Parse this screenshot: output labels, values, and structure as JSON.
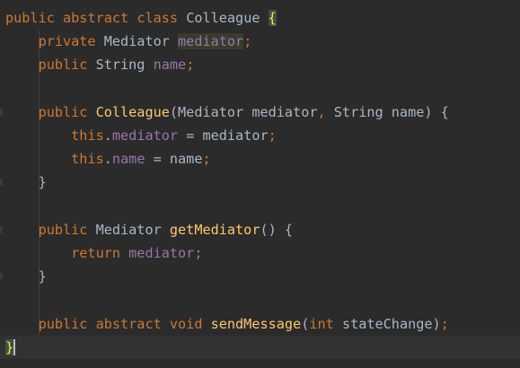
{
  "editor": {
    "lines": [
      {
        "tokens": [
          {
            "t": "public ",
            "c": "kw"
          },
          {
            "t": "abstract ",
            "c": "kw"
          },
          {
            "t": "class ",
            "c": "kw"
          },
          {
            "t": "Colleague ",
            "c": "plain"
          },
          {
            "t": "{",
            "c": "brace-match"
          }
        ]
      },
      {
        "tokens": [
          {
            "t": "    private ",
            "c": "kw"
          },
          {
            "t": "Mediator ",
            "c": "plain"
          },
          {
            "t": "mediator",
            "c": "field hl-usage"
          },
          {
            "t": ";",
            "c": "punc"
          }
        ]
      },
      {
        "tokens": [
          {
            "t": "    public ",
            "c": "kw"
          },
          {
            "t": "String ",
            "c": "plain"
          },
          {
            "t": "name",
            "c": "field"
          },
          {
            "t": ";",
            "c": "punc"
          }
        ]
      },
      {
        "tokens": []
      },
      {
        "tokens": [
          {
            "t": "    public ",
            "c": "kw"
          },
          {
            "t": "Colleague",
            "c": "fn"
          },
          {
            "t": "(Mediator mediator",
            "c": "plain"
          },
          {
            "t": ", ",
            "c": "punc"
          },
          {
            "t": "String name) {",
            "c": "plain"
          }
        ]
      },
      {
        "tokens": [
          {
            "t": "        this",
            "c": "kw"
          },
          {
            "t": ".",
            "c": "plain"
          },
          {
            "t": "mediator",
            "c": "field"
          },
          {
            "t": " = mediator",
            "c": "plain"
          },
          {
            "t": ";",
            "c": "punc"
          }
        ]
      },
      {
        "tokens": [
          {
            "t": "        this",
            "c": "kw"
          },
          {
            "t": ".",
            "c": "plain"
          },
          {
            "t": "name",
            "c": "field"
          },
          {
            "t": " = name",
            "c": "plain"
          },
          {
            "t": ";",
            "c": "punc"
          }
        ]
      },
      {
        "tokens": [
          {
            "t": "    }",
            "c": "plain"
          }
        ]
      },
      {
        "tokens": []
      },
      {
        "tokens": [
          {
            "t": "    public ",
            "c": "kw"
          },
          {
            "t": "Mediator ",
            "c": "plain"
          },
          {
            "t": "getMediator",
            "c": "fn"
          },
          {
            "t": "() {",
            "c": "plain"
          }
        ]
      },
      {
        "tokens": [
          {
            "t": "        return ",
            "c": "kw"
          },
          {
            "t": "mediator",
            "c": "field"
          },
          {
            "t": ";",
            "c": "punc"
          }
        ]
      },
      {
        "tokens": [
          {
            "t": "    }",
            "c": "plain"
          }
        ]
      },
      {
        "tokens": []
      },
      {
        "tokens": [
          {
            "t": "    public ",
            "c": "kw"
          },
          {
            "t": "abstract ",
            "c": "kw"
          },
          {
            "t": "void ",
            "c": "kw"
          },
          {
            "t": "sendMessage",
            "c": "fn"
          },
          {
            "t": "(",
            "c": "plain"
          },
          {
            "t": "int ",
            "c": "kw"
          },
          {
            "t": "stateChange)",
            "c": "plain"
          },
          {
            "t": ";",
            "c": "punc"
          }
        ]
      },
      {
        "tokens": [
          {
            "t": "}",
            "c": "brace-match"
          }
        ]
      }
    ],
    "colors": {
      "background": "#2b2b2b",
      "keyword": "#cc7832",
      "function": "#ffc66d",
      "field": "#9876aa",
      "text": "#a9b7c6"
    }
  }
}
